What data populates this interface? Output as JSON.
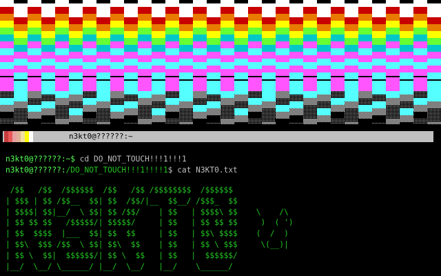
{
  "banner": {
    "band_colors": [
      "#ffffff",
      "#c80000",
      "#e87a00",
      "#ffff00",
      "#66ff33",
      "#00c8c8",
      "#ff55ff",
      "#55ffff"
    ]
  },
  "titlebar": {
    "swatch_colors": [
      "#c83c3c",
      "#e85858",
      "#e8a0a0",
      "#e0b098",
      "#f0e0a0",
      "#ffff00",
      "#ffffff"
    ],
    "text": "n3kt0@??????:~"
  },
  "terminal": {
    "line1": {
      "prompt": "n3kt0@??????:~$ ",
      "command": "cd DO_NOT_TOUCH!!!1!!!1"
    },
    "line2": {
      "prompt": "n3kt0@??????:",
      "path": "/DO_NOT_TOUCH!!!1!!!!1",
      "suffix": "$ ",
      "command": "cat N3KT0.txt"
    },
    "ascii_art": " /$$   /$$  /$$$$$$  /$$   /$$ /$$$$$$$$  /$$$$$$\n| $$$ | $$ /$$__  $$| $$  /$$/|__  $$__/ /$$$_  $$\n| $$$$| $$|__/  \\ $$| $$ /$$/    | $$   | $$$$\\ $$    \\    /\\\n| $$ $$ $$   /$$$$$/| $$$$$/     | $$   | $$ $$ $$     )  ( ')\n| $$  $$$$  |___  $$| $$  $$     | $$   | $$\\ $$$$    (  /  )\n| $$\\  $$$ /$$  \\ $$| $$\\  $$    | $$   | $$ \\ $$$     \\(__)|\n| $$ \\  $$|  $$$$$$/| $$ \\  $$   | $$   |  $$$$$$/\n|__/  \\__/ \\______/ |__/  \\__/   |__/    \\______/"
  }
}
